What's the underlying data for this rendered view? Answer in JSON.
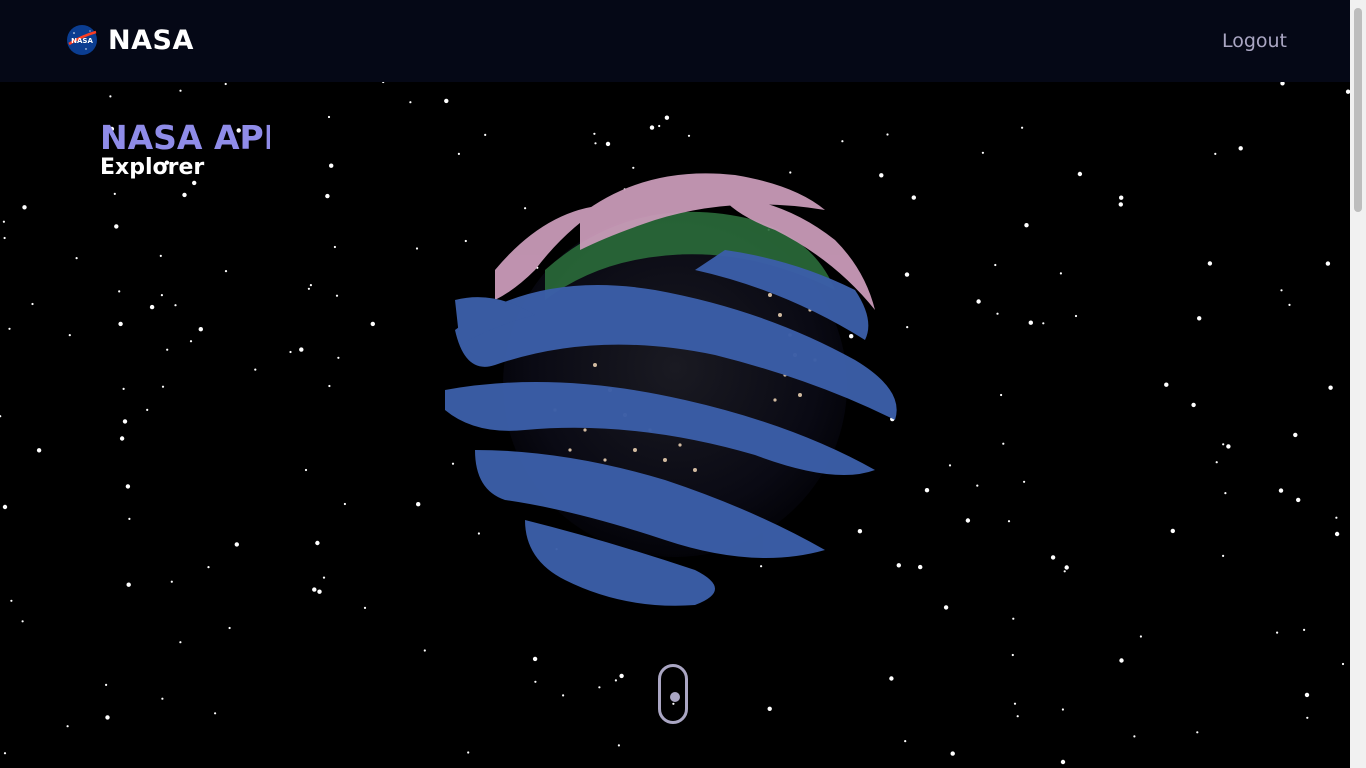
{
  "navbar": {
    "brand": "NASA",
    "logout_label": "Logout"
  },
  "hero": {
    "title": "NASA API",
    "subtitle": "Explorer"
  },
  "icons": {
    "logo": "nasa-logo",
    "scroll": "scroll-indicator-icon"
  },
  "colors": {
    "navbar_bg": "#050816",
    "accent": "#8f8ce8",
    "muted": "#aaa6c3"
  }
}
